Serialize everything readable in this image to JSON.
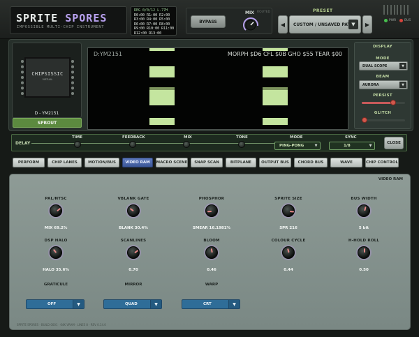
{
  "brand": {
    "title_a": "SPRITE",
    "title_b": "SPORES",
    "subtitle": "IMPOSSIBLE MULTI-CHIP INSTRUMENT"
  },
  "registers": [
    "REG 0/0/12 L-77H",
    "R0:00 R1:00 R2:00",
    "R3:00 R4:00 R5:00",
    "R6:00 R7:00 R8:00",
    "R9:00 R10:00 R11:00",
    "R12:00 R13:00"
  ],
  "header": {
    "bypass": "BYPASS",
    "mix_label": "MIX",
    "routed_label": "ROUTED",
    "mix_value": 0.66
  },
  "preset": {
    "label": "PRESET",
    "name": "CUSTOM / UNSAVED PATCH",
    "prev": "◀",
    "next": "▶",
    "caret": "▼"
  },
  "status": {
    "pwr": "PWR",
    "bus": "BUS",
    "pwr_color": "#47c04e",
    "bus_color": "#d8443c"
  },
  "chip": {
    "brand": "CHIPSISSIC",
    "sub": "VIRTUAL",
    "name": "D - YM2151",
    "button": "SPROUT"
  },
  "scope": {
    "chip": "D:YM2151",
    "meta": "MORPH $D6 CFL $0B GHO $55 TEAR $00"
  },
  "display": {
    "title": "DISPLAY",
    "mode_label": "MODE",
    "mode_value": "DUAL SCOPE",
    "beam_label": "BEAM",
    "beam_value": "AURORA",
    "persist_label": "PERSIST",
    "persist_value": 0.72,
    "glitch_label": "GLITCH",
    "glitch_value": 0.0
  },
  "delay": {
    "label": "DELAY",
    "time_label": "TIME",
    "feedback_label": "FEEDBACK",
    "mix_label": "MIX",
    "tone_label": "TONE",
    "mode_label": "MODE",
    "mode_value": "PING-PONG",
    "sync_label": "SYNC",
    "sync_value": "1/8",
    "close": "CLOSE"
  },
  "tabs": [
    "PERFORM",
    "CHIP LANES",
    "MOTION/BUS",
    "VIDEO RAM",
    "MACRO SCENE",
    "SNAP SCAN",
    "BITPLANE",
    "OUTPUT BUS",
    "CHORD BUS",
    "WAVE",
    "CHIP CONTROL"
  ],
  "active_tab": 3,
  "vram": {
    "title": "VIDEO RAM",
    "knobs_row1": [
      {
        "label": "PAL/NTSC",
        "value": "MIX 69.2%",
        "level": 0.69
      },
      {
        "label": "VBLANK GATE",
        "value": "BLANK 30.4%",
        "level": 0.3
      },
      {
        "label": "PHOSPHOR",
        "value": "SMEAR 16.1981%",
        "level": 0.16
      },
      {
        "label": "SPRITE SIZE",
        "value": "SPR 216",
        "level": 0.85
      },
      {
        "label": "BUS WIDTH",
        "value": "5 bit",
        "level": 0.55
      }
    ],
    "knobs_row2": [
      {
        "label": "DSP HALO",
        "value": "HALO 35.6%",
        "level": 0.36
      },
      {
        "label": "SCANLINES",
        "value": "0.70",
        "level": 0.7
      },
      {
        "label": "BLOOM",
        "value": "0.46",
        "level": 0.46
      },
      {
        "label": "COLOUR CYCLE",
        "value": "0.44",
        "level": 0.44
      },
      {
        "label": "H-HOLD ROLL",
        "value": "0.50",
        "level": 0.5
      }
    ],
    "dropdowns": [
      {
        "label": "GRATICULE",
        "value": "OFF"
      },
      {
        "label": "MIRROR",
        "value": "QUAD"
      },
      {
        "label": "WARP",
        "value": "CRT"
      }
    ],
    "caret": "▼"
  },
  "footer": "SPRITE SPORES · BUILD 0001 · 64K VRAM · LINES 8 · REV 0.14.0"
}
